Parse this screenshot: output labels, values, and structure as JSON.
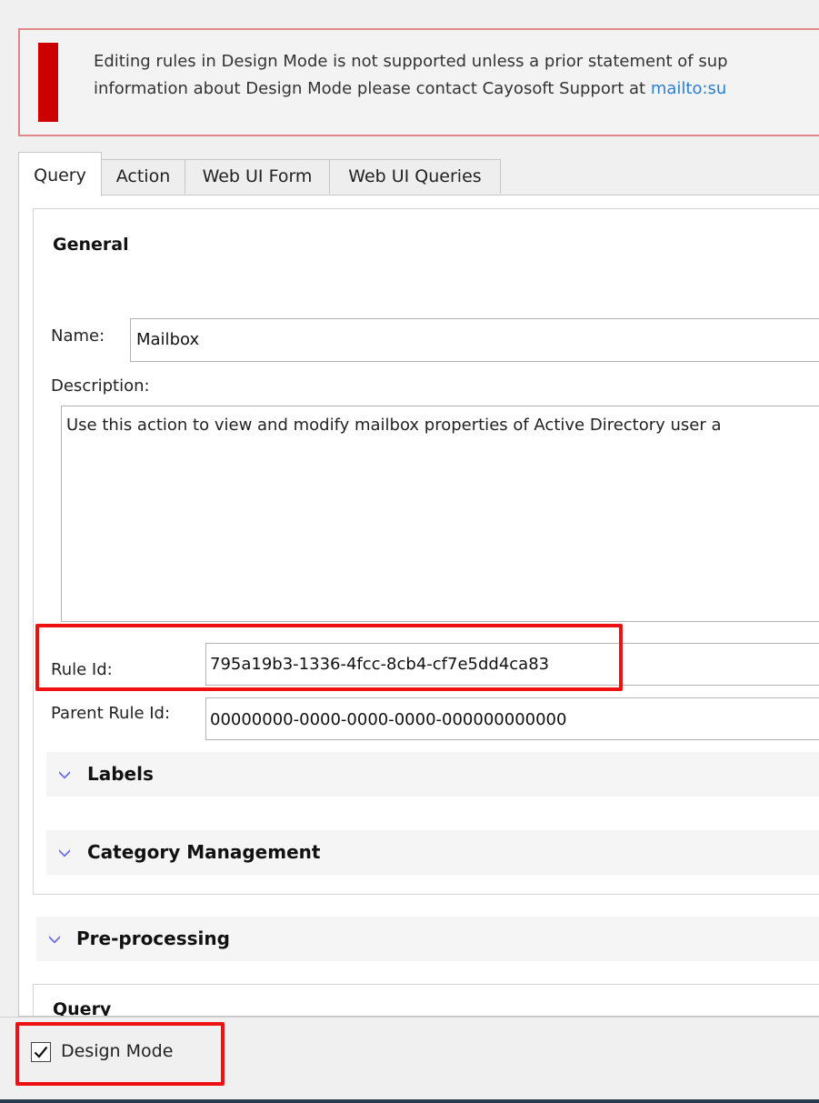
{
  "warning": {
    "text_line1": "Editing rules in Design Mode is not supported unless a prior statement of sup",
    "text_line2_prefix": "information about Design Mode please contact Cayosoft Support at ",
    "link_text": "mailto:su"
  },
  "tabs": [
    {
      "label": "Query",
      "active": true
    },
    {
      "label": "Action",
      "active": false
    },
    {
      "label": "Web UI Form",
      "active": false
    },
    {
      "label": "Web UI Queries",
      "active": false
    }
  ],
  "general": {
    "title": "General",
    "name_label": "Name:",
    "name_value": "Mailbox",
    "description_label": "Description:",
    "description_value": "Use this action to view and modify mailbox properties of Active Directory user a",
    "rule_id_label": "Rule Id:",
    "rule_id_value": "795a19b3-1336-4fcc-8cb4-cf7e5dd4ca83",
    "parent_rule_id_label": "Parent Rule Id:",
    "parent_rule_id_value": "00000000-0000-0000-0000-000000000000"
  },
  "expanders": {
    "labels": "Labels",
    "category_management": "Category Management",
    "pre_processing": "Pre-processing"
  },
  "query_section_title": "Query",
  "design_mode": {
    "label": "Design Mode",
    "checked": true
  },
  "colors": {
    "highlight": "#ee1111",
    "warning_bar": "#cc0000",
    "link": "#2a7fd4",
    "chevron": "#6c6cf0"
  }
}
